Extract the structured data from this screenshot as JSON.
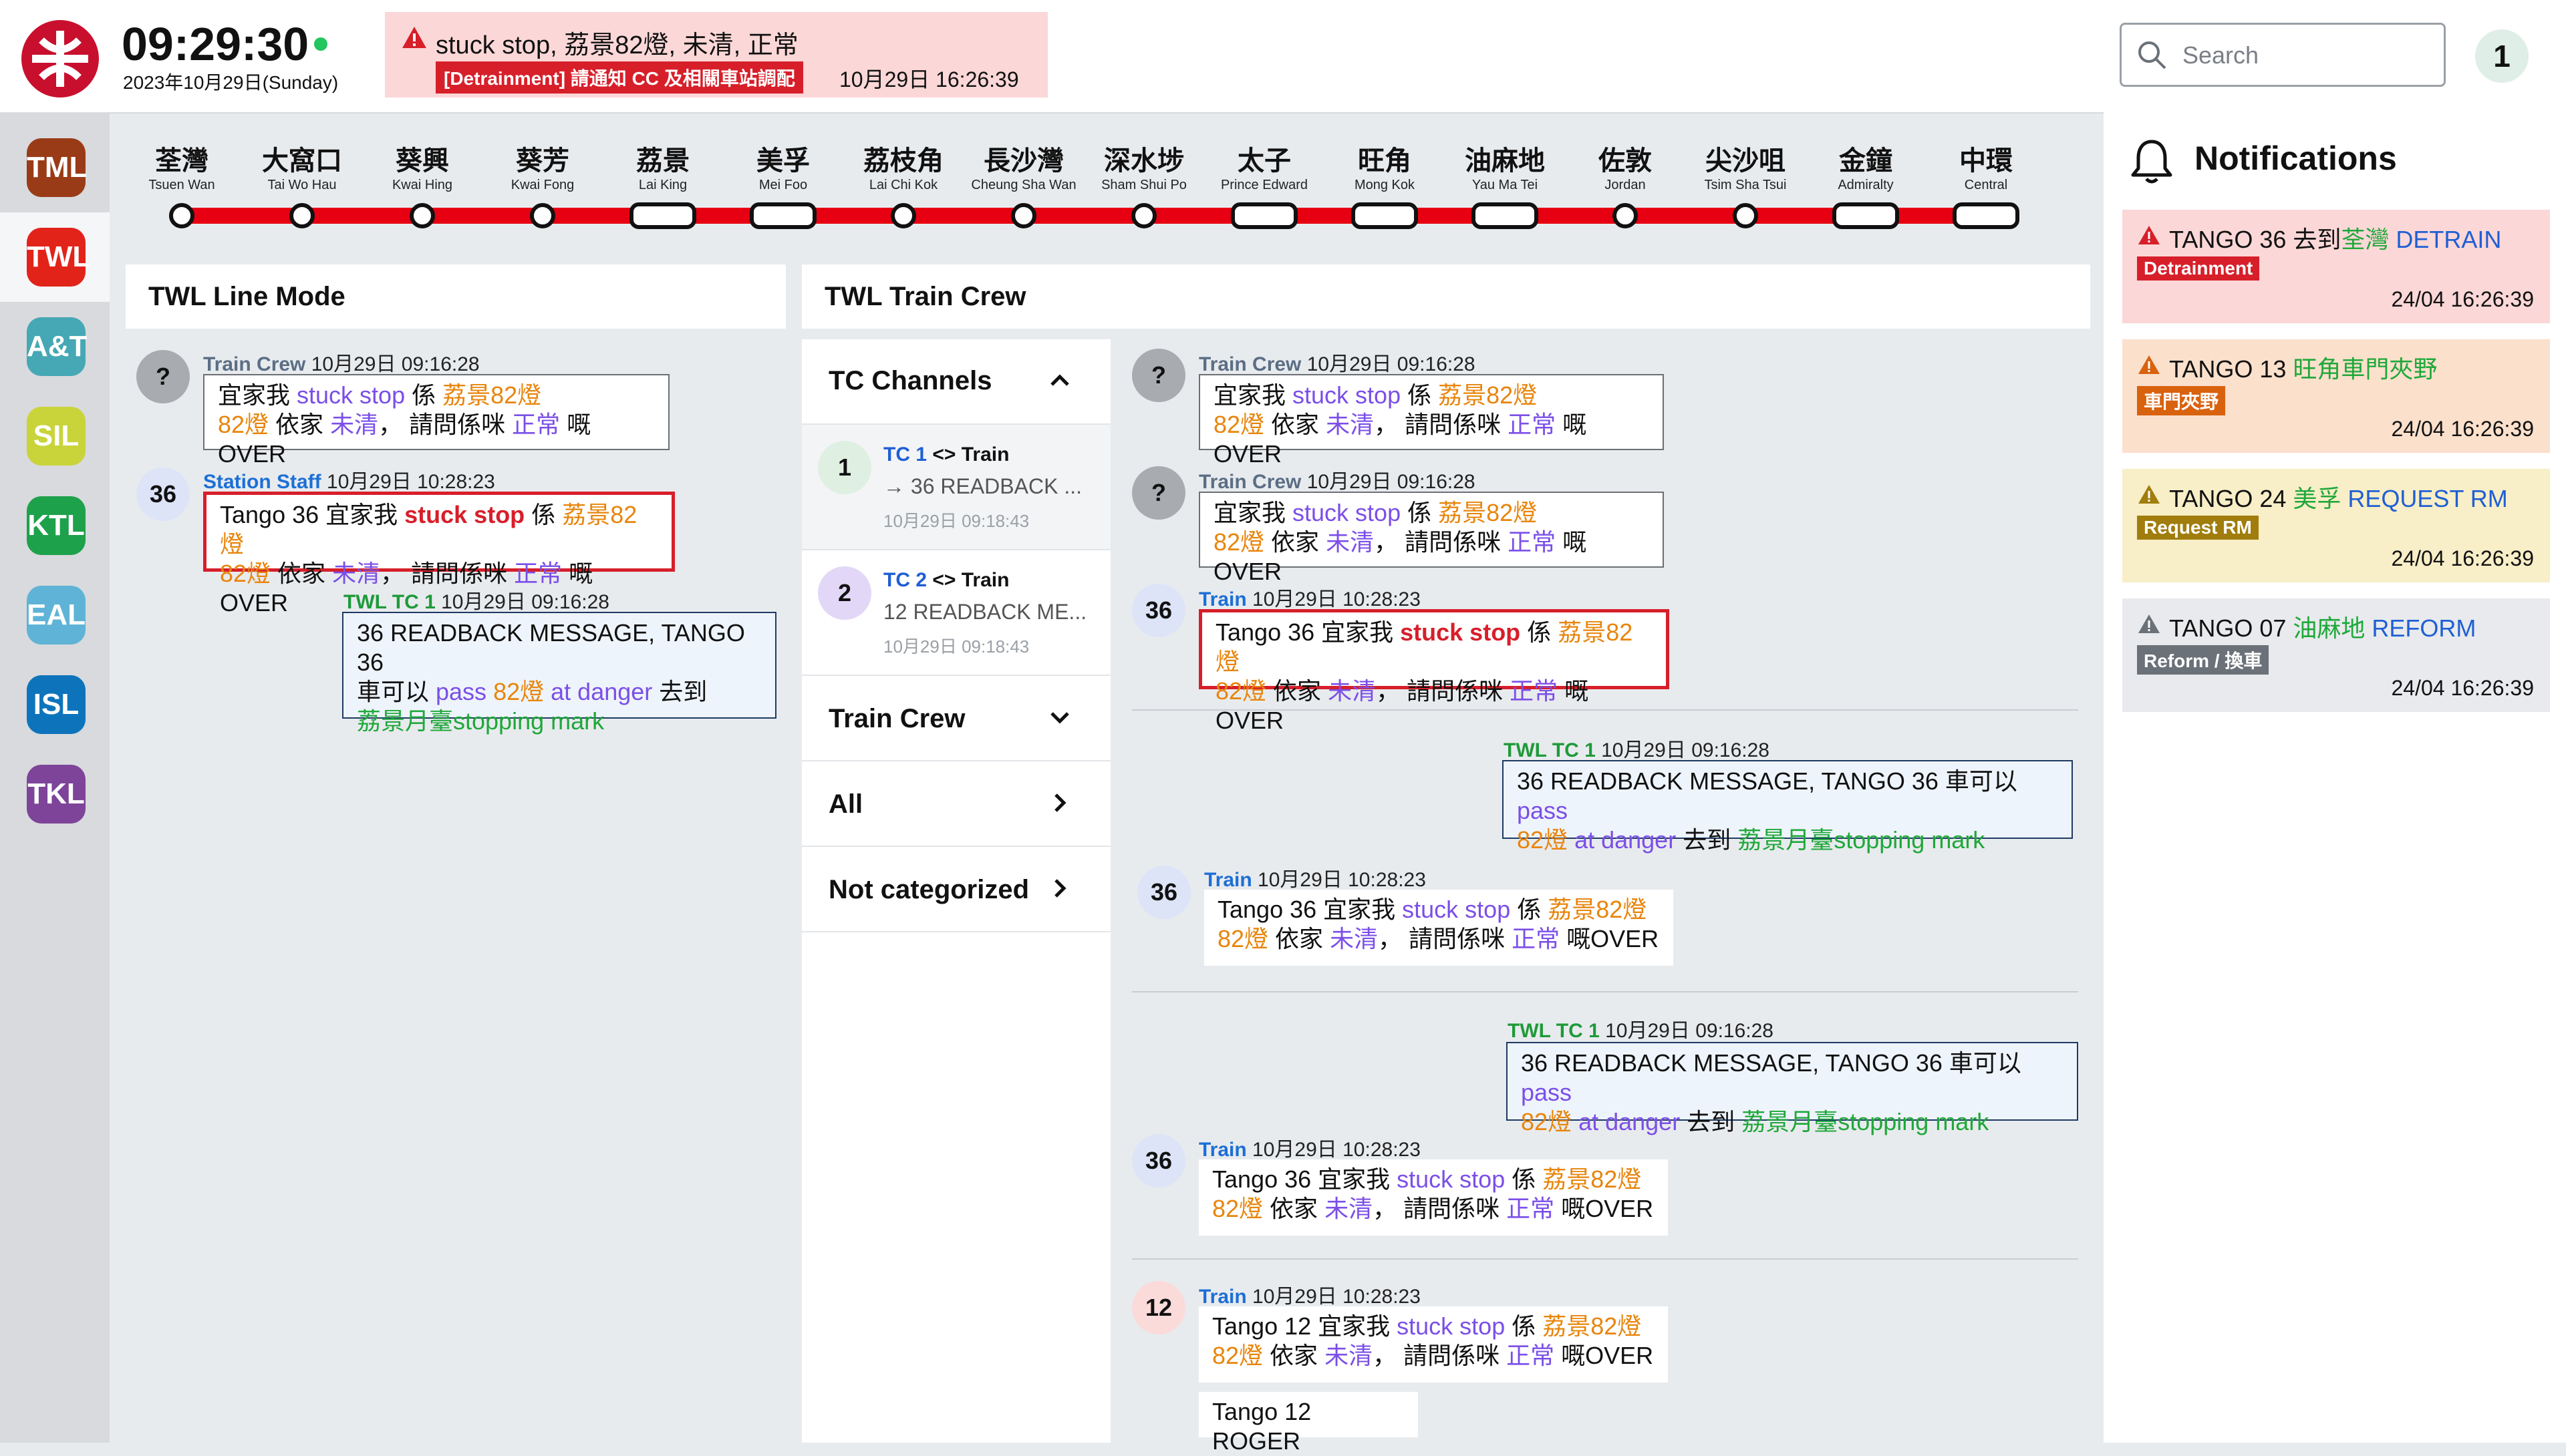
{
  "header": {
    "time": "09:29:30",
    "date": "2023年10月29日(Sunday)",
    "alert": {
      "text": "stuck stop, 荔景82燈, 未清, 正常",
      "tag": "[Detrainment] 請通知 CC 及相關車站調配",
      "time": "10月29日 16:26:39"
    },
    "search_placeholder": "Search",
    "user_count": "1"
  },
  "colors": {
    "mtr_red": "#c8102e",
    "line_red": "#e60012"
  },
  "lines": [
    {
      "code": "TML",
      "color": "#9a3b17",
      "selected": false
    },
    {
      "code": "TWL",
      "color": "#e2231a",
      "selected": true
    },
    {
      "code": "A&T",
      "color": "#46a7b5",
      "selected": false
    },
    {
      "code": "SIL",
      "color": "#c8d43a",
      "selected": false
    },
    {
      "code": "KTL",
      "color": "#1ea14b",
      "selected": false
    },
    {
      "code": "EAL",
      "color": "#5fb3d6",
      "selected": false
    },
    {
      "code": "ISL",
      "color": "#0d74bc",
      "selected": false
    },
    {
      "code": "TKL",
      "color": "#7d4499",
      "selected": false
    }
  ],
  "stations": [
    {
      "zh": "荃灣",
      "en": "Tsuen Wan",
      "marker": "dot"
    },
    {
      "zh": "大窩口",
      "en": "Tai Wo Hau",
      "marker": "dot"
    },
    {
      "zh": "葵興",
      "en": "Kwai Hing",
      "marker": "dot"
    },
    {
      "zh": "葵芳",
      "en": "Kwai Fong",
      "marker": "dot"
    },
    {
      "zh": "荔景",
      "en": "Lai King",
      "marker": "pill"
    },
    {
      "zh": "美孚",
      "en": "Mei Foo",
      "marker": "pill"
    },
    {
      "zh": "荔枝角",
      "en": "Lai Chi Kok",
      "marker": "dot"
    },
    {
      "zh": "長沙灣",
      "en": "Cheung Sha Wan",
      "marker": "dot"
    },
    {
      "zh": "深水埗",
      "en": "Sham Shui Po",
      "marker": "dot"
    },
    {
      "zh": "太子",
      "en": "Prince Edward",
      "marker": "pill"
    },
    {
      "zh": "旺角",
      "en": "Mong Kok",
      "marker": "pill"
    },
    {
      "zh": "油麻地",
      "en": "Yau Ma Tei",
      "marker": "pill"
    },
    {
      "zh": "佐敦",
      "en": "Jordan",
      "marker": "dot"
    },
    {
      "zh": "尖沙咀",
      "en": "Tsim Sha Tsui",
      "marker": "dot"
    },
    {
      "zh": "金鐘",
      "en": "Admiralty",
      "marker": "pill"
    },
    {
      "zh": "中環",
      "en": "Central",
      "marker": "pill"
    }
  ],
  "line_mode": {
    "title": "TWL Line Mode",
    "messages": [
      {
        "avatar": "?",
        "sender": "Train Crew",
        "time": "10月29日 09:16:28",
        "l1": [
          "宜家我 ",
          "stuck stop",
          " 係 ",
          "荔景82燈"
        ],
        "l2": [
          "82燈",
          " 依家 ",
          "未清",
          "， 請問係咪 ",
          "正常",
          " 嘅OVER"
        ]
      },
      {
        "avatar": "36",
        "sender": "Station Staff",
        "time": "10月29日 10:28:23",
        "l1": [
          "Tango 36 宜家我 ",
          "stuck stop",
          " 係 ",
          "荔景82燈"
        ],
        "l2": [
          "82燈",
          " 依家 ",
          "未清",
          "， 請問係咪 ",
          "正常",
          " 嘅OVER"
        ]
      },
      {
        "sender": "TWL TC 1",
        "time": "10月29日 09:16:28",
        "l1": "36 READBACK MESSAGE, TANGO 36",
        "l2": [
          "車可以 ",
          "pass",
          " ",
          "82燈",
          " ",
          "at danger",
          " 去到"
        ],
        "l3": [
          "荔景月臺stopping mark"
        ]
      }
    ]
  },
  "train_crew": {
    "title": "TWL Train Crew",
    "channels_header": "TC Channels",
    "channels": [
      {
        "avatar": "1",
        "label": "TC 1",
        "suffix": " <> Train",
        "preview": "36 READBACK ...",
        "time": "10月29日 09:18:43"
      },
      {
        "avatar": "2",
        "label": "TC 2",
        "suffix": " <> Train",
        "preview": "12 READBACK ME...",
        "time": "10月29日 09:18:43"
      }
    ],
    "groups": [
      {
        "label": "Train Crew",
        "chevron": "down"
      },
      {
        "label": "All",
        "chevron": "right"
      },
      {
        "label": "Not categorized",
        "chevron": "right"
      }
    ],
    "feed": [
      {
        "avatar": "?",
        "sender": "Train Crew",
        "time": "10月29日 09:16:28"
      },
      {
        "avatar": "?",
        "sender": "Train Crew",
        "time": "10月29日 09:16:28"
      },
      {
        "avatar": "36",
        "sender": "Train",
        "time": "10月29日 10:28:23"
      },
      {
        "sender": "TWL TC 1",
        "time": "10月29日 09:16:28"
      },
      {
        "avatar": "36",
        "sender": "Train",
        "time": "10月29日 10:28:23"
      },
      {
        "sender": "TWL TC 1",
        "time": "10月29日 09:16:28"
      },
      {
        "avatar": "36",
        "sender": "Train",
        "time": "10月29日 10:28:23"
      },
      {
        "avatar": "12",
        "sender": "Train",
        "time": "10月29日 10:28:23"
      }
    ],
    "msg_a1": "宜家我 ",
    "stuck": "stuck stop",
    "kei": " 係 ",
    "laiking82": "荔景82燈",
    "light82": "82燈",
    "yika": " 依家 ",
    "weiching": "未清",
    "ask": "， 請問係咪 ",
    "normal": "正常",
    "over": " 嘅OVER",
    "tango36": "Tango 36 宜家我 ",
    "tango12": "Tango 12 宜家我 ",
    "rb1": "36 READBACK MESSAGE, TANGO 36 車可以 ",
    "pass": "pass",
    "space": " ",
    "atdanger": "at danger",
    "qudao": " 去到 ",
    "stopmark": "荔景月臺stopping mark",
    "roger": "Tango 12 ROGER"
  },
  "notifications": {
    "title": "Notifications",
    "items": [
      {
        "prefix": "TANGO 36 去到",
        "place": "荃灣",
        "action": "DETRAIN",
        "tag": "Detrainment",
        "time": "24/04 16:26:39",
        "bg": "#fbd7d7",
        "tag_bg": "#d71f2a",
        "icon_color": "#d71f2a"
      },
      {
        "prefix": "TANGO 13 ",
        "place": "旺角車門夾野",
        "action": "",
        "tag": "車門夾野",
        "time": "24/04 16:26:39",
        "bg": "#fbe0cc",
        "tag_bg": "#d9620f",
        "icon_color": "#d9620f"
      },
      {
        "prefix": "TANGO 24 ",
        "place": "美孚",
        "action": "REQUEST RM",
        "tag": "Request RM",
        "time": "24/04 16:26:39",
        "bg": "#f8eec7",
        "tag_bg": "#a07d0c",
        "icon_color": "#a07d0c"
      },
      {
        "prefix": "TANGO 07 ",
        "place": "油麻地",
        "action": "REFORM",
        "tag": "Reform / 換車",
        "time": "24/04 16:26:39",
        "bg": "#e8eaed",
        "tag_bg": "#6b7178",
        "icon_color": "#6b7178"
      }
    ]
  }
}
